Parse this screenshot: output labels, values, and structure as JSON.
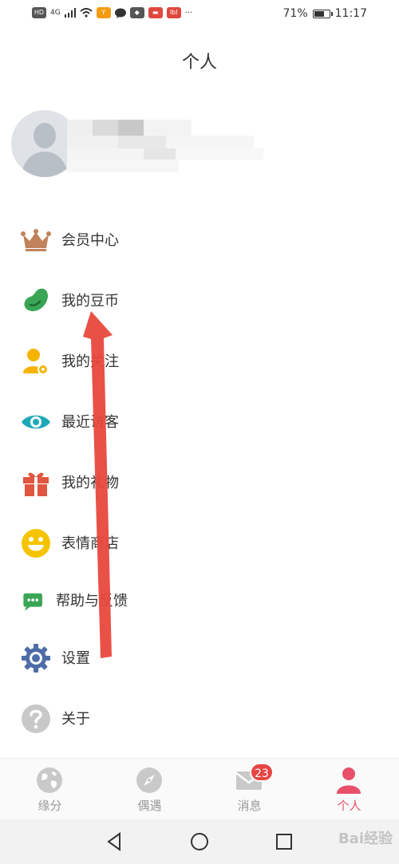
{
  "status_bar": {
    "left_icons": [
      "HD",
      "4G",
      "signal-icon",
      "wifi-icon",
      "app-icon",
      "message-icon",
      "app-icon",
      "app-icon",
      "app-icon",
      "..."
    ],
    "hd": "HD",
    "network": "4G",
    "more": "···",
    "battery": "71%",
    "battery_level": 0.71,
    "time": "11:17"
  },
  "header": {
    "title": "个人"
  },
  "profile": {
    "avatar": "default-avatar-icon"
  },
  "menu": {
    "items": [
      {
        "label": "会员中心",
        "icon": "crown-icon",
        "color": "#c0825a"
      },
      {
        "label": "我的豆币",
        "icon": "bean-icon",
        "color": "#3aa655"
      },
      {
        "label": "我的关注",
        "icon": "user-follow-icon",
        "color": "#f5b400"
      },
      {
        "label": "最近访客",
        "icon": "eye-icon",
        "color": "#1ea9b8"
      },
      {
        "label": "我的礼物",
        "icon": "gift-icon",
        "color": "#e05640"
      },
      {
        "label": "表情商店",
        "icon": "smiley-icon",
        "color": "#f5c400"
      },
      {
        "label": "帮助与反馈",
        "icon": "chat-bubble-icon",
        "color": "#3aa655"
      },
      {
        "label": "设置",
        "icon": "gear-icon",
        "color": "#4d6ca8"
      },
      {
        "label": "关于",
        "icon": "question-icon",
        "color": "#c8c8c8"
      }
    ]
  },
  "tab_bar": {
    "tabs": [
      {
        "label": "缘分",
        "icon": "globe-icon"
      },
      {
        "label": "偶遇",
        "icon": "compass-icon"
      },
      {
        "label": "消息",
        "icon": "envelope-icon",
        "badge": "23"
      },
      {
        "label": "个人",
        "icon": "person-icon",
        "active": true
      }
    ],
    "active_color": "#e8506a"
  },
  "nav_bar": {
    "buttons": [
      "back-icon",
      "home-icon",
      "recents-icon"
    ]
  },
  "watermark": "Bai经验"
}
